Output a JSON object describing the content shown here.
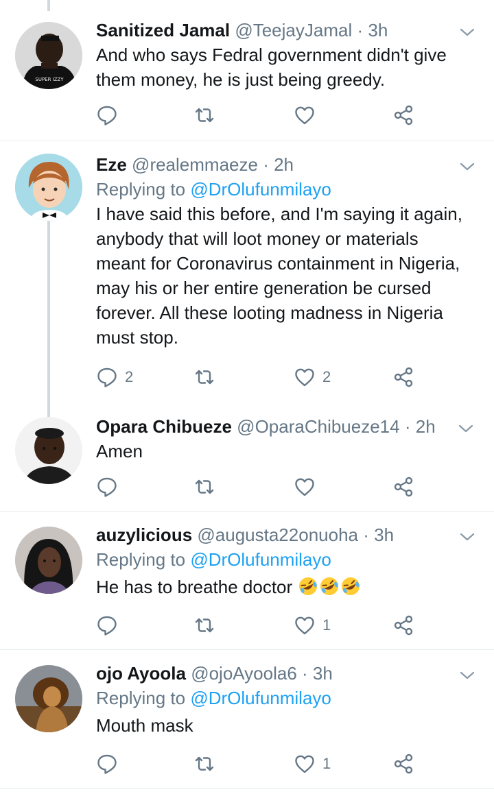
{
  "tweets": [
    {
      "name": "Sanitized Jamal",
      "handle": "@TeejayJamal",
      "dot": "·",
      "time": "3h",
      "reply_prefix": "",
      "reply_mention": "",
      "lines": [
        "And who says Fedral government didn't give",
        "them money, he is just being greedy."
      ],
      "reply_count": "",
      "retweet_count": "",
      "like_count": "",
      "avatar_shirt_text": "SUPER IZZY"
    },
    {
      "name": "Eze",
      "handle": "@realemmaeze",
      "dot": "·",
      "time": "2h",
      "reply_prefix": "Replying to",
      "reply_mention": "@DrOlufunmilayo",
      "lines": [
        "I have said this before, and I'm saying it again,",
        "anybody that will loot money or materials",
        "meant for Coronavirus containment in Nigeria,",
        "may his or her entire generation be cursed",
        "forever. All these looting madness in Nigeria",
        "must stop."
      ],
      "reply_count": "2",
      "retweet_count": "",
      "like_count": "2"
    },
    {
      "name": "Opara Chibueze",
      "handle": "@OparaChibueze14",
      "dot": "·",
      "time": "2h",
      "reply_prefix": "",
      "reply_mention": "",
      "lines": [
        "Amen"
      ],
      "reply_count": "",
      "retweet_count": "",
      "like_count": ""
    },
    {
      "name": "auzylicious",
      "handle": "@augusta22onuoha",
      "dot": "·",
      "time": "3h",
      "reply_prefix": "Replying to",
      "reply_mention": "@DrOlufunmilayo",
      "lines": [
        "He has to breathe doctor"
      ],
      "emoji": "rolling-on-floor-laughing x3",
      "reply_count": "",
      "retweet_count": "",
      "like_count": "1"
    },
    {
      "name": "ojo Ayoola",
      "handle": "@ojoAyoola6",
      "dot": "·",
      "time": "3h",
      "reply_prefix": "Replying to",
      "reply_mention": "@DrOlufunmilayo",
      "lines": [
        "Mouth mask"
      ],
      "reply_count": "",
      "retweet_count": "",
      "like_count": "1"
    }
  ],
  "colors": {
    "accent": "#1da1f2",
    "muted": "#657786",
    "text": "#14171a",
    "divider": "#e6ecf0",
    "thread_line": "#cfd9de"
  },
  "icons": [
    "reply-icon",
    "retweet-icon",
    "like-icon",
    "share-icon",
    "chevron-down-icon"
  ]
}
